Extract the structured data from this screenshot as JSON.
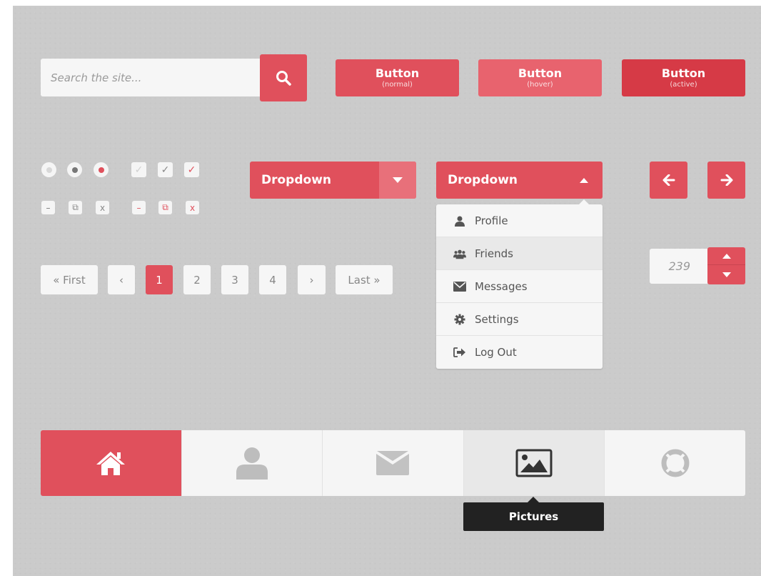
{
  "colors": {
    "accent": "#e0505c",
    "accent_hover": "#e8636e",
    "accent_active": "#d63a46",
    "surface": "#f6f6f6",
    "background": "#cbcbcb",
    "tooltip": "#222222"
  },
  "search": {
    "placeholder": "Search the site...",
    "icon": "search-icon"
  },
  "buttons": [
    {
      "label": "Button",
      "state": "(normal)"
    },
    {
      "label": "Button",
      "state": "(hover)"
    },
    {
      "label": "Button",
      "state": "(active)"
    }
  ],
  "radios": [
    "off",
    "grey",
    "selected"
  ],
  "checks": [
    "light",
    "grey",
    "red"
  ],
  "mini_controls": [
    {
      "minus": "–",
      "copy": "⧉",
      "x": "x"
    },
    {
      "minus": "–",
      "copy": "⧉",
      "x": "x"
    }
  ],
  "dropdown_closed": {
    "label": "Dropdown",
    "icon": "caret-down-icon"
  },
  "dropdown_open": {
    "label": "Dropdown",
    "icon": "caret-up-icon",
    "items": [
      {
        "label": "Profile",
        "icon": "user-icon"
      },
      {
        "label": "Friends",
        "icon": "users-icon",
        "highlighted": true
      },
      {
        "label": "Messages",
        "icon": "envelope-icon"
      },
      {
        "label": "Settings",
        "icon": "gear-icon"
      },
      {
        "label": "Log Out",
        "icon": "sign-out-icon"
      }
    ]
  },
  "arrows": {
    "prev": "arrow-left-icon",
    "next": "arrow-right-icon"
  },
  "pagination": {
    "first": "« First",
    "prev": "‹",
    "pages": [
      "1",
      "2",
      "3",
      "4"
    ],
    "current": "1",
    "next": "›",
    "last": "Last »"
  },
  "stepper": {
    "value": "239"
  },
  "tabbar": {
    "tabs": [
      {
        "icon": "home-icon",
        "active": true
      },
      {
        "icon": "user-icon"
      },
      {
        "icon": "envelope-icon"
      },
      {
        "icon": "picture-icon",
        "hover": true
      },
      {
        "icon": "lifebuoy-icon"
      }
    ],
    "tooltip": "Pictures"
  }
}
